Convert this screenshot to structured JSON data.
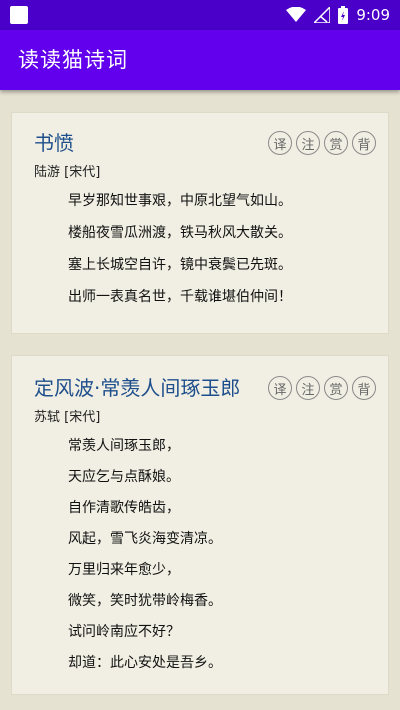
{
  "status_bar": {
    "time": "9:09",
    "icons": [
      "wifi-icon",
      "signal-icon",
      "battery-charging-icon"
    ]
  },
  "app_bar": {
    "title": "读读猫诗词"
  },
  "action_labels": [
    "译",
    "注",
    "赏",
    "背"
  ],
  "poems": [
    {
      "title": "书愤",
      "author": "陆游 [宋代]",
      "lines": [
        "早岁那知世事艰，中原北望气如山。",
        "楼船夜雪瓜洲渡，铁马秋风大散关。",
        "塞上长城空自许，镜中衰鬓已先斑。",
        "出师一表真名世，千载谁堪伯仲间！"
      ]
    },
    {
      "title": "定风波·常羡人间琢玉郎",
      "author": "苏轼 [宋代]",
      "lines": [
        "常羡人间琢玉郎，",
        "天应乞与点酥娘。",
        "自作清歌传皓齿，",
        "风起，雪飞炎海变清凉。",
        "万里归来年愈少，",
        "微笑，笑时犹带岭梅香。",
        "试问岭南应不好？",
        "却道：此心安处是吾乡。"
      ]
    }
  ],
  "colors": {
    "status_bar": "#4a00c8",
    "app_bar": "#6200ee",
    "background": "#e6e2d1",
    "card": "#f1efe3",
    "title": "#1e4f8c"
  }
}
